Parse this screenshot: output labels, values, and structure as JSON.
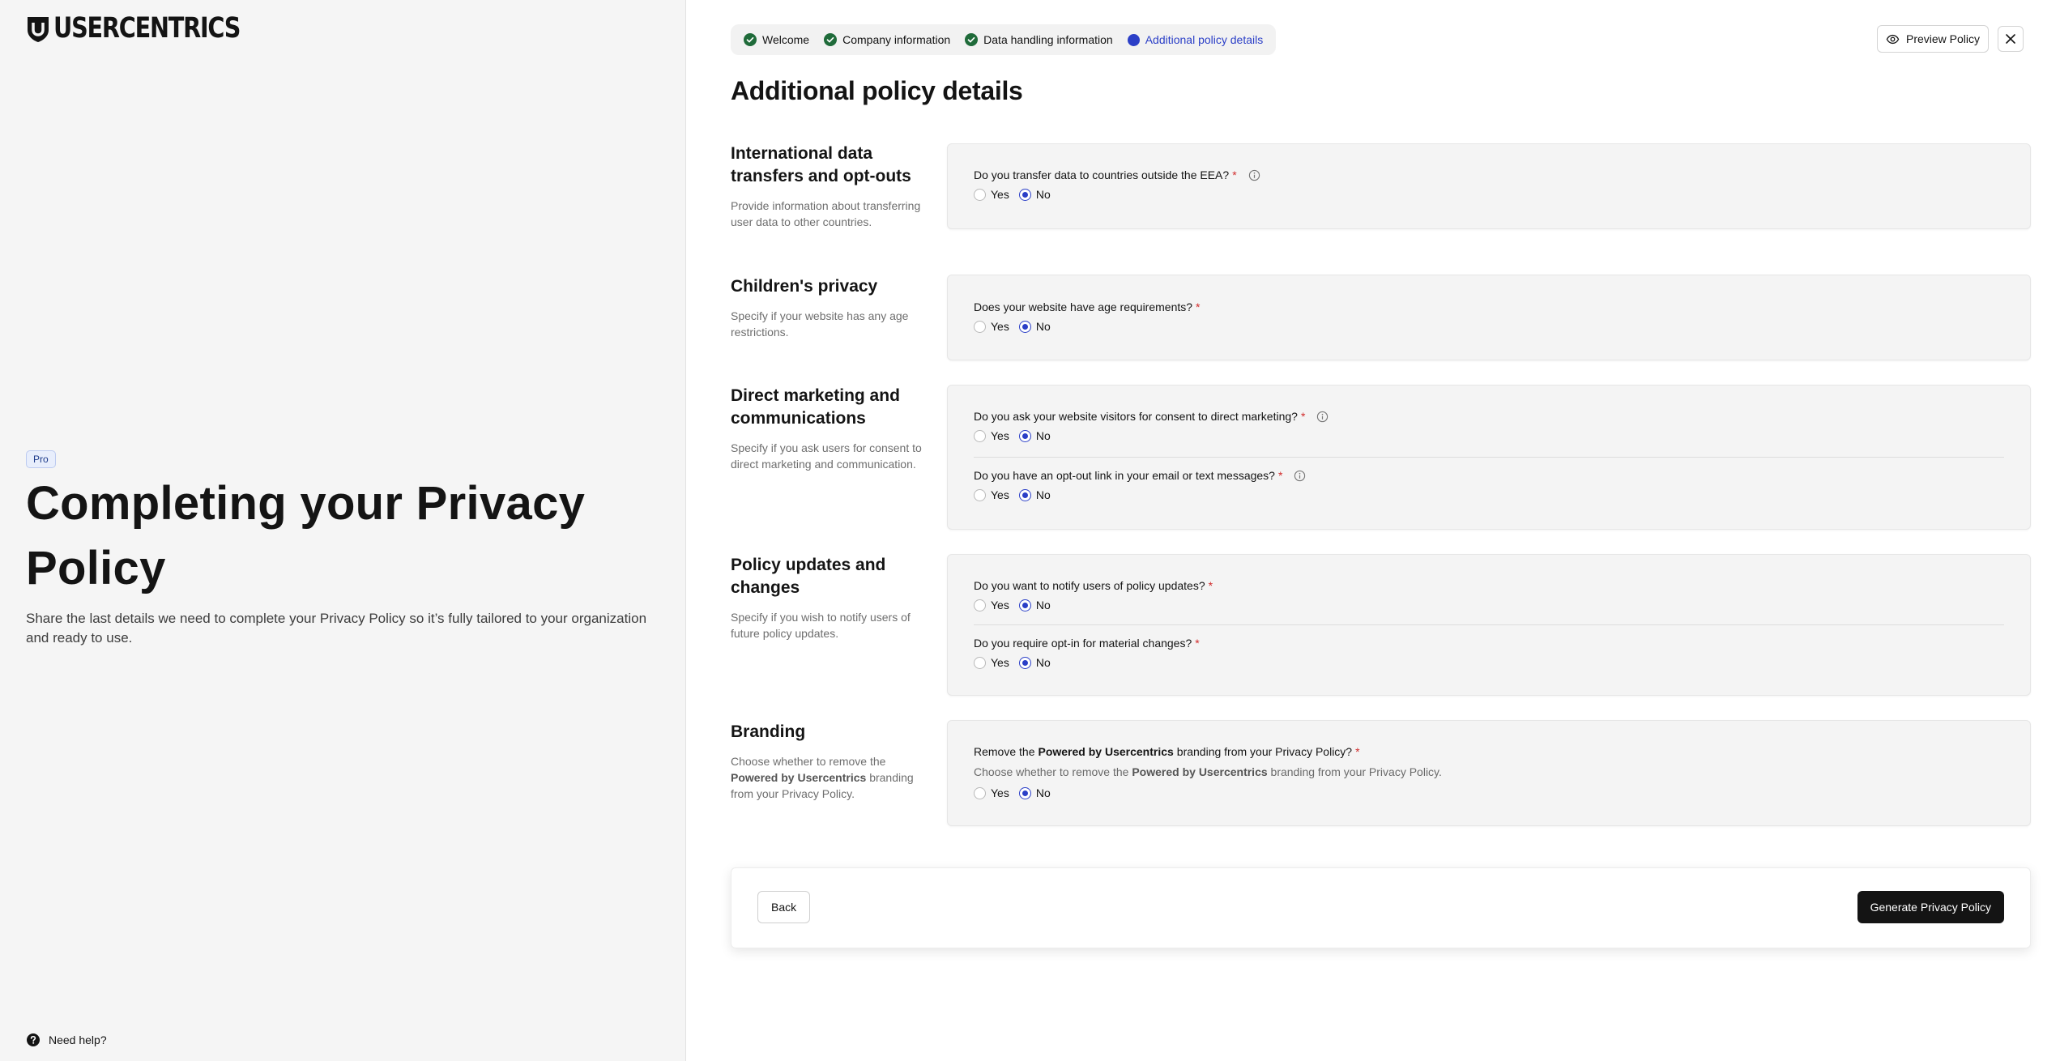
{
  "brand": {
    "name": "USERCENTRICS",
    "icon": "usercentrics-shield-logo"
  },
  "left": {
    "badge": "Pro",
    "title": "Completing your Privacy Policy",
    "description": "Share the last details we need to complete your Privacy Policy so it’s fully tailored to your organization and ready to use.",
    "help_label": "Need help?"
  },
  "stepper": {
    "steps": [
      {
        "label": "Welcome",
        "status": "done"
      },
      {
        "label": "Company information",
        "status": "done"
      },
      {
        "label": "Data handling information",
        "status": "done"
      },
      {
        "label": "Additional policy details",
        "status": "active"
      }
    ]
  },
  "toolbar": {
    "preview_label": "Preview Policy"
  },
  "page_title": "Additional policy details",
  "sections": {
    "international": {
      "title": "International data transfers and opt-outs",
      "desc": "Provide information about transferring user data to other countries.",
      "q1": {
        "text": "Do you transfer data to countries outside the EEA?",
        "yes": "Yes",
        "no": "No",
        "selected": "No"
      }
    },
    "children": {
      "title": "Children's privacy",
      "desc": "Specify if your website has any age restrictions.",
      "q1": {
        "text": "Does your website have age requirements?",
        "yes": "Yes",
        "no": "No",
        "selected": "No"
      }
    },
    "marketing": {
      "title": "Direct marketing and communications",
      "desc": "Specify if you ask users for consent to direct marketing and communication.",
      "q1": {
        "text": "Do you ask your website visitors for consent to direct marketing?",
        "yes": "Yes",
        "no": "No",
        "selected": "No"
      },
      "q2": {
        "text": "Do you have an opt-out link in your email or text messages?",
        "yes": "Yes",
        "no": "No",
        "selected": "No"
      }
    },
    "updates": {
      "title": "Policy updates and changes",
      "desc": "Specify if you wish to notify users of future policy updates.",
      "q1": {
        "text": "Do you want to notify users of policy updates?",
        "yes": "Yes",
        "no": "No",
        "selected": "No"
      },
      "q2": {
        "text": "Do you require opt-in for material changes?",
        "yes": "Yes",
        "no": "No",
        "selected": "No"
      }
    },
    "branding": {
      "title": "Branding",
      "desc_pre": "Choose whether to remove the",
      "desc_bold": "Powered by Usercentrics",
      "desc_post": "branding from your Privacy Policy.",
      "q1": {
        "text_pre": "Remove the",
        "text_bold": "Powered by Usercentrics",
        "text_post": "branding from your Privacy Policy?",
        "sub_pre": "Choose whether to remove the",
        "sub_bold": "Powered by Usercentrics",
        "sub_post": "branding from your Privacy Policy.",
        "yes": "Yes",
        "no": "No",
        "selected": "No"
      }
    }
  },
  "required_marker": "*",
  "footer": {
    "back_label": "Back",
    "generate_label": "Generate Privacy Policy"
  },
  "colors": {
    "accent": "#2b3fc7",
    "success": "#1f6b3a",
    "required": "#d12b2b",
    "primary_button": "#141414"
  }
}
